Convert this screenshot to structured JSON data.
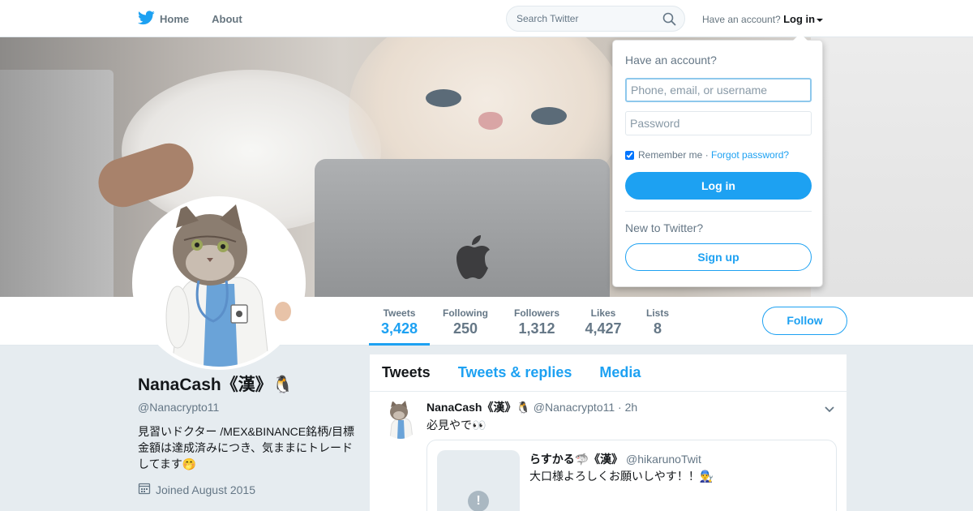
{
  "nav": {
    "home_label": "Home",
    "about_label": "About",
    "search_placeholder": "Search Twitter",
    "account_prompt": "Have an account?",
    "login_label": "Log in"
  },
  "profile": {
    "name": "NanaCash《漢》🐧",
    "handle": "@Nanacrypto11",
    "bio": "見習いドクター /MEX&BINANCE銘柄/目標金額は達成済みにつき、気ままにトレードしてます🤭",
    "joined": "Joined August 2015"
  },
  "stats": [
    {
      "label": "Tweets",
      "value": "3,428"
    },
    {
      "label": "Following",
      "value": "250"
    },
    {
      "label": "Followers",
      "value": "1,312"
    },
    {
      "label": "Likes",
      "value": "4,427"
    },
    {
      "label": "Lists",
      "value": "8"
    }
  ],
  "follow_label": "Follow",
  "tabs": [
    {
      "label": "Tweets"
    },
    {
      "label": "Tweets & replies"
    },
    {
      "label": "Media"
    }
  ],
  "tweet": {
    "author": "NanaCash《漢》🐧",
    "handle": "@Nanacrypto11",
    "time": "· 2h",
    "text": "必見やで👀",
    "quote": {
      "author": "らすかる🦈《漢》",
      "handle": "@hikarunoTwit",
      "text": "大口様よろしくお願いしやす！！👨‍🔧"
    }
  },
  "login_dropdown": {
    "prompt": "Have an account?",
    "username_placeholder": "Phone, email, or username",
    "password_placeholder": "Password",
    "remember_label": "Remember me ·",
    "forgot_label": "Forgot password?",
    "login_button": "Log in",
    "new_prompt": "New to Twitter?",
    "signup_button": "Sign up"
  },
  "colors": {
    "brand": "#1da1f2",
    "background": "#e6ecf0",
    "muted_text": "#657786"
  }
}
